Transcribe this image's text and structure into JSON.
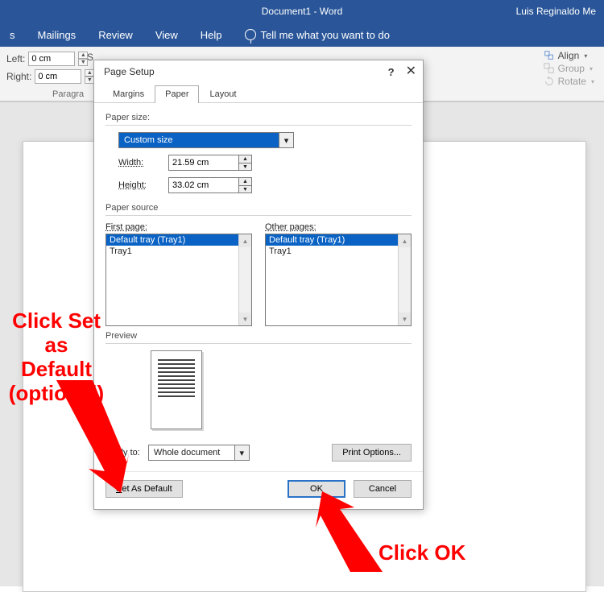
{
  "app": {
    "doc_title": "Document1 - Word",
    "user": "Luis Reginaldo Me"
  },
  "ribbon": {
    "tabs": [
      "s",
      "Mailings",
      "Review",
      "View",
      "Help"
    ],
    "tellme": "Tell me what you want to do",
    "indent": {
      "left_label": "Left:",
      "left_val": "0 cm",
      "right_label": "Right:",
      "right_val": "0 cm"
    },
    "spacing_letter": "S",
    "group_label": "Paragra",
    "align": {
      "align": "Align",
      "group": "Group",
      "rotate": "Rotate"
    }
  },
  "dialog": {
    "title": "Page Setup",
    "tabs": {
      "margins": "Margins",
      "paper": "Paper",
      "layout": "Layout"
    },
    "paper_size_label": "Paper size:",
    "paper_size_value": "Custom size",
    "width_label": "Width:",
    "width_value": "21.59 cm",
    "height_label": "Height:",
    "height_value": "33.02 cm",
    "paper_source_label": "Paper source",
    "first_page_label": "First page:",
    "other_pages_label": "Other pages:",
    "tray_default": "Default tray (Tray1)",
    "tray1": "Tray1",
    "preview_label": "Preview",
    "apply_label": "pply to:",
    "apply_value": "Whole document",
    "print_options": "Print Options...",
    "set_default": "Set As Default",
    "ok": "OK",
    "cancel": "Cancel"
  },
  "annotations": {
    "set_default": "Click Set as Default (optional)",
    "click_ok": "Click OK"
  }
}
